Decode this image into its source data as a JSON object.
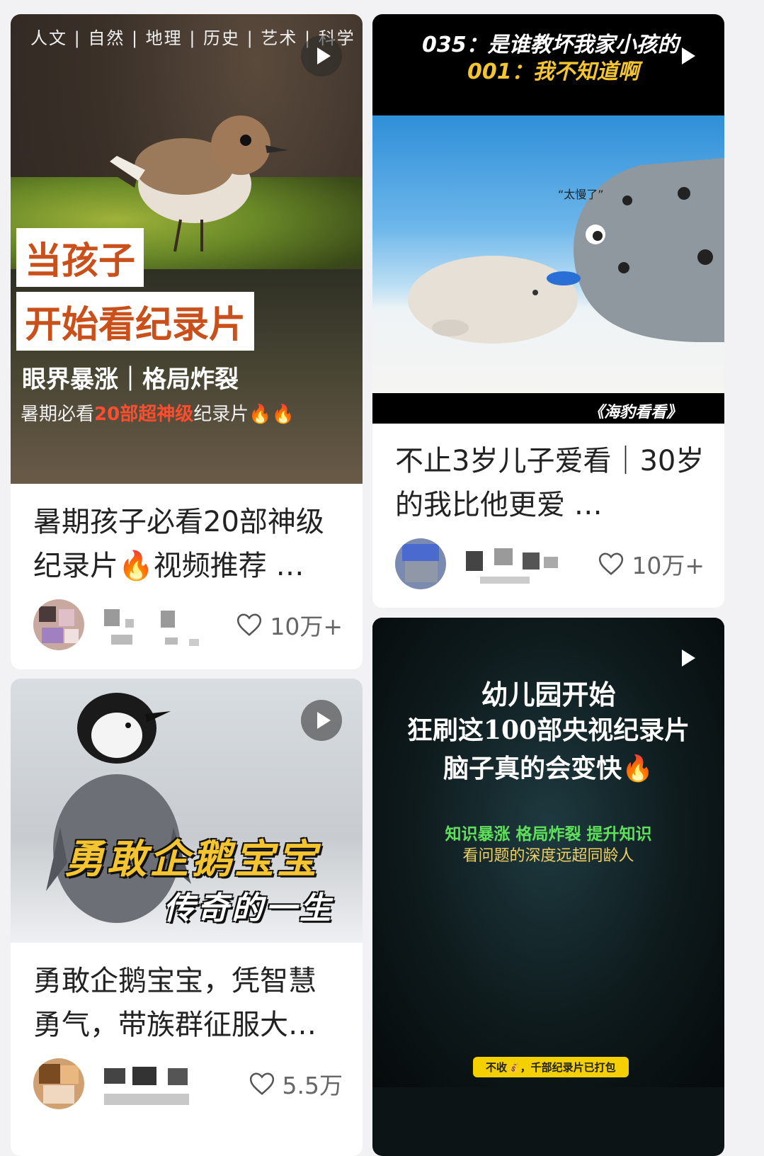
{
  "cards": [
    {
      "cover": {
        "category_bar": "人文 | 自然 | 地理 | 历史 | 艺术 | 科学",
        "headline_1": "当孩子",
        "headline_2": "开始看纪录片",
        "sub_1": "眼界暴涨｜格局炸裂",
        "sub_2_prefix": "暑期必看",
        "sub_2_highlight": "20部超神级",
        "sub_2_suffix": "纪录片🔥🔥"
      },
      "title": "暑期孩子必看20部神级纪录片🔥视频推荐 …",
      "likes": "10万+"
    },
    {
      "cover": {
        "caption_1": "035：是谁教坏我家小孩的",
        "caption_2": "001：我不知道啊",
        "speech": "“太慢了”",
        "footer": "《海豹看看》"
      },
      "title": "不止3岁儿子爱看｜30岁的我比他更爱 …",
      "likes": "10万+"
    },
    {
      "cover": {
        "headline_1": "勇敢企鹅宝宝",
        "headline_2": "传奇的一生"
      },
      "title": "勇敢企鹅宝宝，凭智慧勇气，带族群征服大…",
      "likes": "5.5万"
    },
    {
      "cover": {
        "line_1": "幼儿园开始",
        "line_2": "狂刷这100部央视纪录片",
        "line_3": "脑子真的会变快🔥",
        "green_line": "知识暴涨 格局炸裂 提升知识",
        "yellow_line": "看问题的深度远超同龄人",
        "badge": "不收💰，千部纪录片已打包"
      }
    }
  ],
  "colors": {
    "accent_yellow": "#f5c531",
    "accent_green": "#5fe05a",
    "highlight_red": "#ff4d2d"
  }
}
